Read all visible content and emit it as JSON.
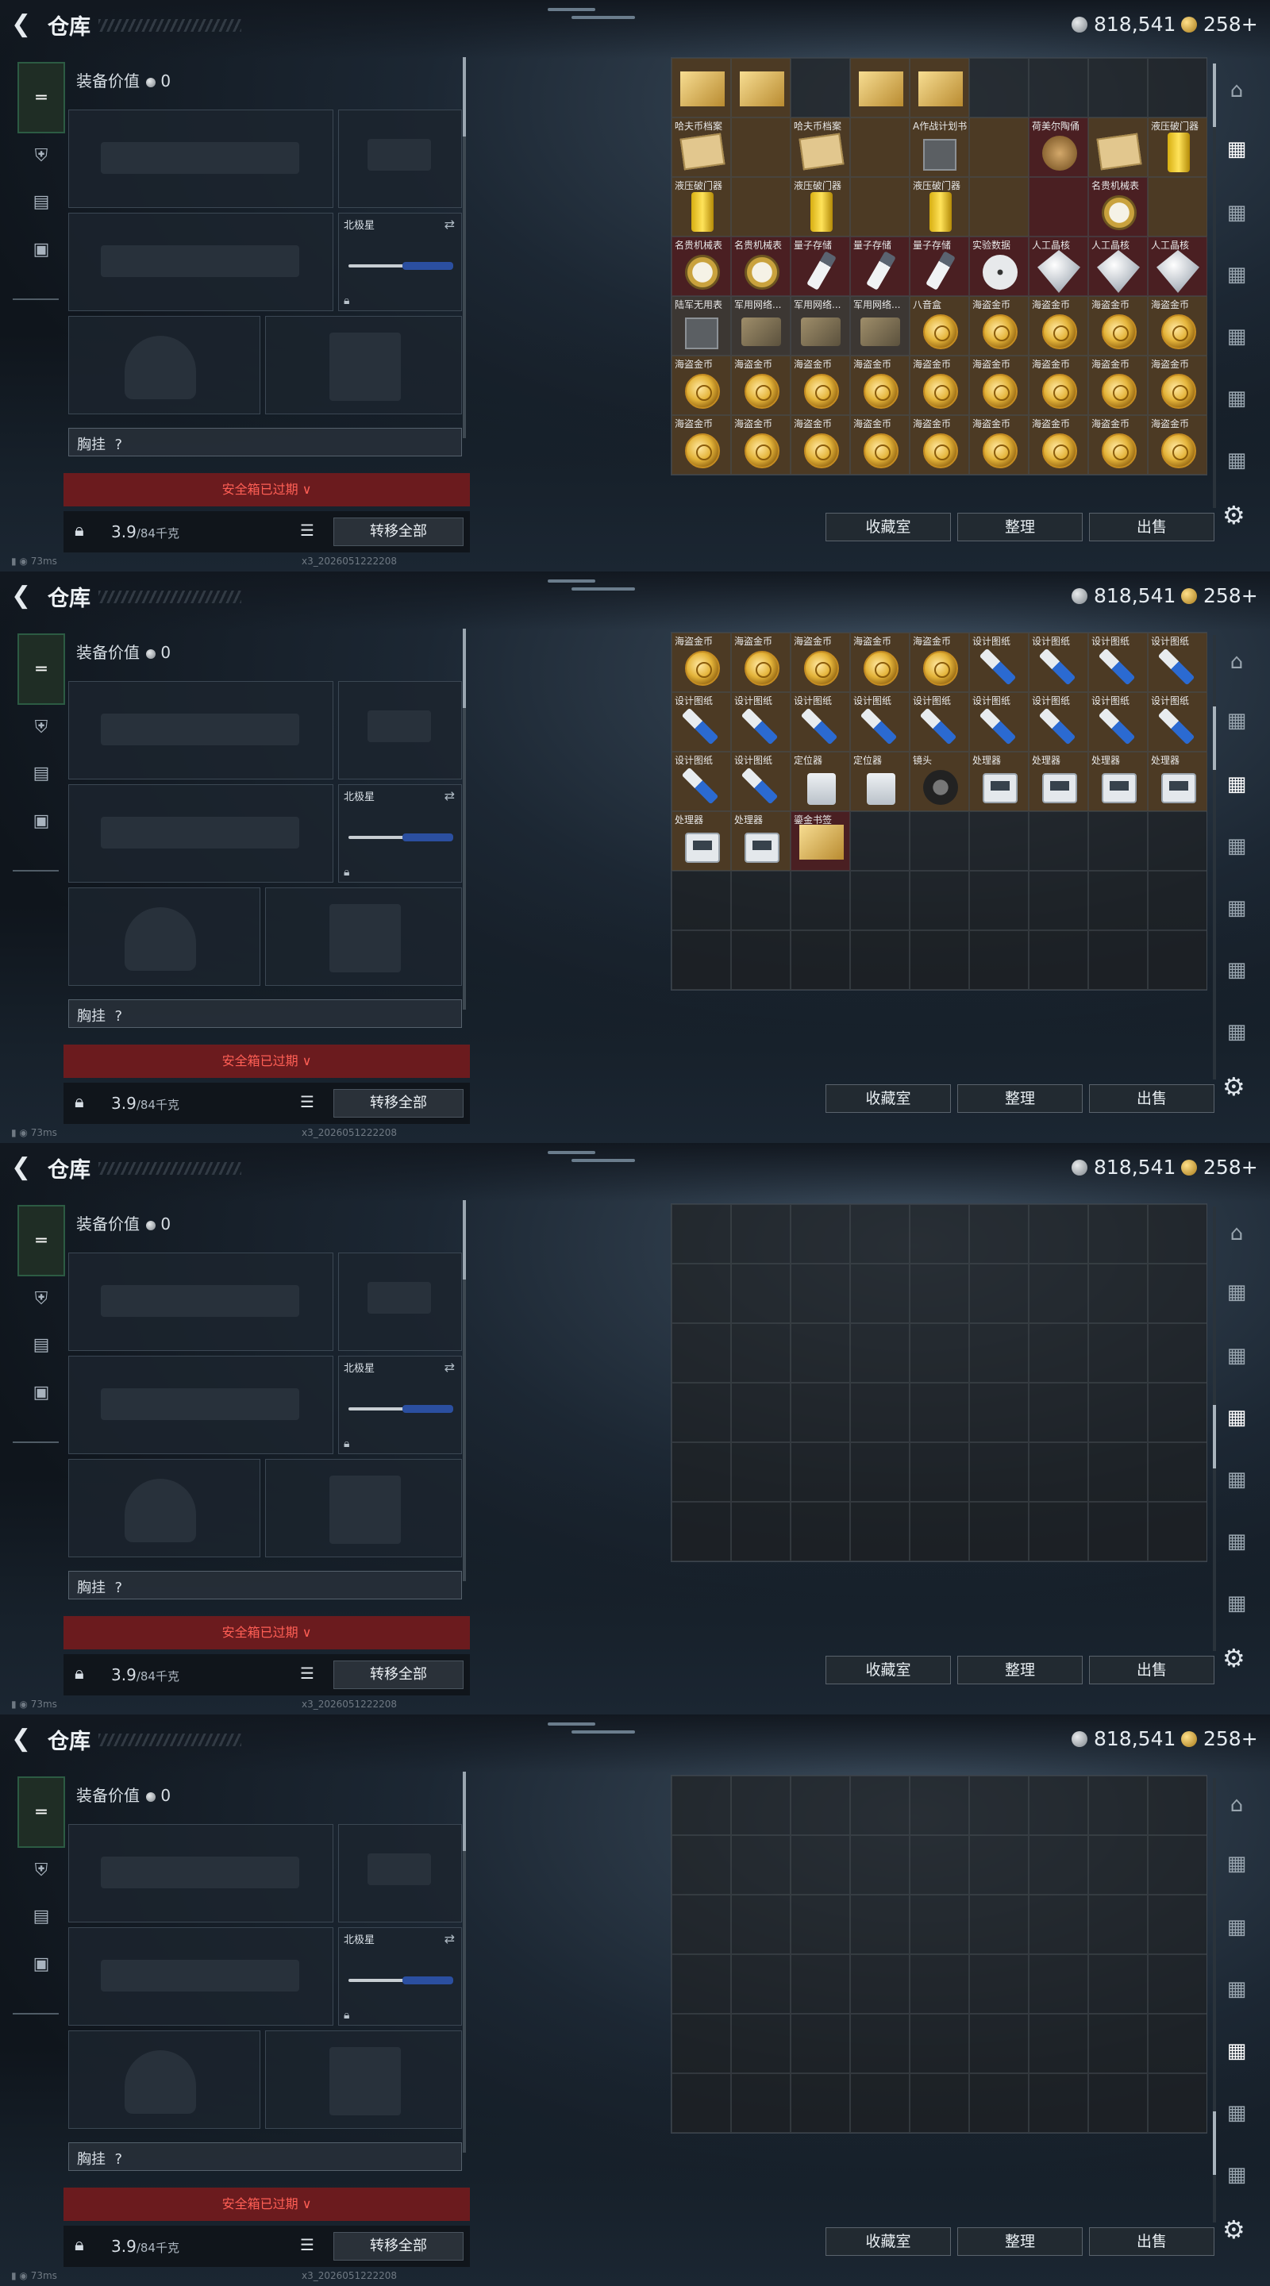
{
  "topbar": {
    "back_icon": "chevron-left-icon",
    "title": "仓库",
    "silver": "818,541",
    "gold": "258+"
  },
  "equip": {
    "value_label": "装备价值",
    "value": "0",
    "melee_label": "北极星",
    "chest_label": "胸挂",
    "chest_value": "?",
    "safebox": "安全箱已过期",
    "weight": "3.9",
    "weight_max": "/84千克",
    "move_all": "转移全部"
  },
  "buttons": {
    "collection": "收藏室",
    "organize": "整理",
    "sell": "出售"
  },
  "status": {
    "ping": "73ms",
    "build": "x3_2026051222208"
  },
  "screens": [
    {
      "cells": [
        {
          "l": "",
          "i": "gold",
          "c": "fill"
        },
        {
          "l": "",
          "i": "gold",
          "c": "fill"
        },
        {
          "l": "",
          "i": "",
          "c": ""
        },
        {
          "l": "",
          "i": "gold",
          "c": "fill"
        },
        {
          "l": "",
          "i": "gold",
          "c": "fill"
        },
        {
          "l": "",
          "i": "",
          "c": ""
        },
        {
          "l": "",
          "i": "",
          "c": ""
        },
        {
          "l": "",
          "i": "",
          "c": ""
        },
        {
          "l": "",
          "i": "",
          "c": ""
        },
        {
          "l": "哈夫币档案",
          "i": "map",
          "c": "fill"
        },
        {
          "l": "",
          "i": "",
          "c": "fill"
        },
        {
          "l": "哈夫币档案",
          "i": "map",
          "c": "fill"
        },
        {
          "l": "",
          "i": "",
          "c": "fill"
        },
        {
          "l": "A作战计划书",
          "i": "box",
          "c": "fill"
        },
        {
          "l": "",
          "i": "",
          "c": "fill"
        },
        {
          "l": "荷美尔陶俑",
          "i": "bronze",
          "c": "red"
        },
        {
          "l": "",
          "i": "map",
          "c": "fill"
        },
        {
          "l": "液压破门器",
          "i": "tank",
          "c": "fill"
        },
        {
          "l": "液压破门器",
          "i": "tank",
          "c": "fill"
        },
        {
          "l": "",
          "i": "",
          "c": "fill"
        },
        {
          "l": "液压破门器",
          "i": "tank",
          "c": "fill"
        },
        {
          "l": "",
          "i": "",
          "c": "fill"
        },
        {
          "l": "液压破门器",
          "i": "tank",
          "c": "fill"
        },
        {
          "l": "",
          "i": "",
          "c": "fill"
        },
        {
          "l": "",
          "i": "",
          "c": "red"
        },
        {
          "l": "名贵机械表",
          "i": "watch",
          "c": "red"
        },
        {
          "l": "",
          "i": "",
          "c": "fill"
        },
        {
          "l": "名贵机械表",
          "i": "watch",
          "c": "red"
        },
        {
          "l": "名贵机械表",
          "i": "watch",
          "c": "red"
        },
        {
          "l": "量子存储",
          "i": "usb",
          "c": "red"
        },
        {
          "l": "量子存储",
          "i": "usb",
          "c": "red"
        },
        {
          "l": "量子存储",
          "i": "usb",
          "c": "red"
        },
        {
          "l": "实验数据",
          "i": "disc",
          "c": "red"
        },
        {
          "l": "人工晶核",
          "i": "diamond",
          "c": "red"
        },
        {
          "l": "人工晶核",
          "i": "diamond",
          "c": "red"
        },
        {
          "l": "人工晶核",
          "i": "diamond",
          "c": "red"
        },
        {
          "l": "陆军无用表",
          "i": "box",
          "c": "gray"
        },
        {
          "l": "军用网络...",
          "i": "cloth",
          "c": "gray"
        },
        {
          "l": "军用网络...",
          "i": "cloth",
          "c": "gray"
        },
        {
          "l": "军用网络...",
          "i": "cloth",
          "c": "gray"
        },
        {
          "l": "八音盒",
          "i": "coin",
          "c": "fill"
        },
        {
          "l": "海盗金币",
          "i": "coin",
          "c": "fill"
        },
        {
          "l": "海盗金币",
          "i": "coin",
          "c": "fill"
        },
        {
          "l": "海盗金币",
          "i": "coin",
          "c": "fill"
        },
        {
          "l": "海盗金币",
          "i": "coin",
          "c": "fill"
        },
        {
          "l": "海盗金币",
          "i": "coin",
          "c": "fill"
        },
        {
          "l": "海盗金币",
          "i": "coin",
          "c": "fill"
        },
        {
          "l": "海盗金币",
          "i": "coin",
          "c": "fill"
        },
        {
          "l": "海盗金币",
          "i": "coin",
          "c": "fill"
        },
        {
          "l": "海盗金币",
          "i": "coin",
          "c": "fill"
        },
        {
          "l": "海盗金币",
          "i": "coin",
          "c": "fill"
        },
        {
          "l": "海盗金币",
          "i": "coin",
          "c": "fill"
        },
        {
          "l": "海盗金币",
          "i": "coin",
          "c": "fill"
        },
        {
          "l": "海盗金币",
          "i": "coin",
          "c": "fill"
        },
        {
          "l": "海盗金币",
          "i": "coin",
          "c": "fill"
        },
        {
          "l": "海盗金币",
          "i": "coin",
          "c": "fill"
        },
        {
          "l": "海盗金币",
          "i": "coin",
          "c": "fill"
        },
        {
          "l": "海盗金币",
          "i": "coin",
          "c": "fill"
        },
        {
          "l": "海盗金币",
          "i": "coin",
          "c": "fill"
        },
        {
          "l": "海盗金币",
          "i": "coin",
          "c": "fill"
        },
        {
          "l": "海盗金币",
          "i": "coin",
          "c": "fill"
        },
        {
          "l": "海盗金币",
          "i": "coin",
          "c": "fill"
        },
        {
          "l": "海盗金币",
          "i": "coin",
          "c": "fill"
        }
      ]
    },
    {
      "cells": [
        {
          "l": "海盗金币",
          "i": "coin",
          "c": "fill"
        },
        {
          "l": "海盗金币",
          "i": "coin",
          "c": "fill"
        },
        {
          "l": "海盗金币",
          "i": "coin",
          "c": "fill"
        },
        {
          "l": "海盗金币",
          "i": "coin",
          "c": "fill"
        },
        {
          "l": "海盗金币",
          "i": "coin",
          "c": "fill"
        },
        {
          "l": "设计图纸",
          "i": "blue",
          "c": "fill"
        },
        {
          "l": "设计图纸",
          "i": "blue",
          "c": "fill"
        },
        {
          "l": "设计图纸",
          "i": "blue",
          "c": "fill"
        },
        {
          "l": "设计图纸",
          "i": "blue",
          "c": "fill"
        },
        {
          "l": "设计图纸",
          "i": "blue",
          "c": "fill"
        },
        {
          "l": "设计图纸",
          "i": "blue",
          "c": "fill"
        },
        {
          "l": "设计图纸",
          "i": "blue",
          "c": "fill"
        },
        {
          "l": "设计图纸",
          "i": "blue",
          "c": "fill"
        },
        {
          "l": "设计图纸",
          "i": "blue",
          "c": "fill"
        },
        {
          "l": "设计图纸",
          "i": "blue",
          "c": "fill"
        },
        {
          "l": "设计图纸",
          "i": "blue",
          "c": "fill"
        },
        {
          "l": "设计图纸",
          "i": "blue",
          "c": "fill"
        },
        {
          "l": "设计图纸",
          "i": "blue",
          "c": "fill"
        },
        {
          "l": "设计图纸",
          "i": "blue",
          "c": "fill"
        },
        {
          "l": "设计图纸",
          "i": "blue",
          "c": "fill"
        },
        {
          "l": "定位器",
          "i": "white",
          "c": "fill"
        },
        {
          "l": "定位器",
          "i": "white",
          "c": "fill"
        },
        {
          "l": "镜头",
          "i": "lens",
          "c": "fill"
        },
        {
          "l": "处理器",
          "i": "device",
          "c": "fill"
        },
        {
          "l": "处理器",
          "i": "device",
          "c": "fill"
        },
        {
          "l": "处理器",
          "i": "device",
          "c": "fill"
        },
        {
          "l": "处理器",
          "i": "device",
          "c": "fill"
        },
        {
          "l": "处理器",
          "i": "device",
          "c": "fill"
        },
        {
          "l": "处理器",
          "i": "device",
          "c": "fill"
        },
        {
          "l": "鎏金书签",
          "i": "gold",
          "c": "red"
        }
      ]
    },
    {
      "cells": []
    },
    {
      "cells": []
    }
  ]
}
